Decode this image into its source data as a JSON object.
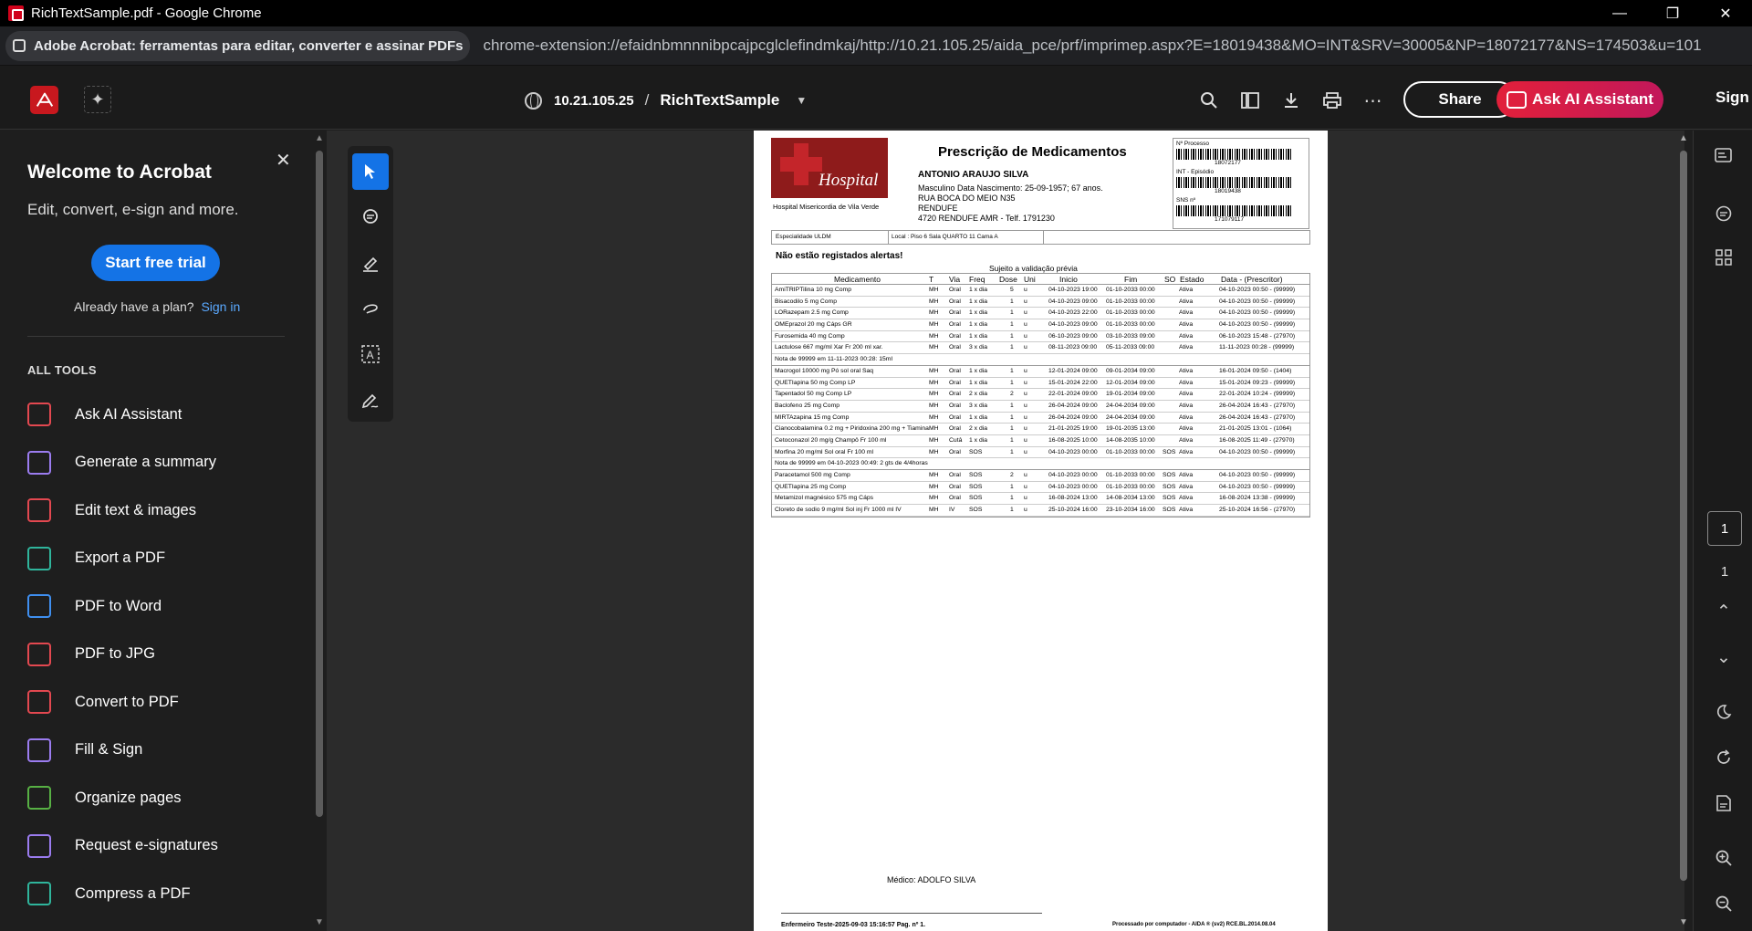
{
  "window": {
    "title": "RichTextSample.pdf - Google Chrome",
    "controls": [
      "—",
      "❐",
      "✕"
    ]
  },
  "addressbar": {
    "extension_label": "Adobe Acrobat: ferramentas para editar, converter e assinar PDFs",
    "url": "chrome-extension://efaidnbmnnnibpcajpcglclefindmkaj/http://10.21.105.25/aida_pce/prf/imprimep.aspx?E=18019438&MO=INT&SRV=30005&NP=18072177&NS=174503&u=101"
  },
  "toolbar": {
    "host": "10.21.105.25",
    "separator": "/",
    "document": "RichTextSample",
    "share_label": "Share",
    "ai_label": "Ask AI Assistant",
    "signin_label": "Sign in",
    "icons": [
      "search-icon",
      "pages-icon",
      "download-icon",
      "print-icon",
      "more-icon"
    ]
  },
  "left_panel": {
    "title": "Welcome to Acrobat",
    "subtitle": "Edit, convert, e-sign and more.",
    "trial_label": "Start free trial",
    "plan_text": "Already have a plan?",
    "plan_link": "Sign in",
    "section": "ALL TOOLS",
    "tools": [
      {
        "label": "Ask AI Assistant",
        "color": "#e34850"
      },
      {
        "label": "Generate a summary",
        "color": "#9b7cf0"
      },
      {
        "label": "Edit text & images",
        "color": "#e34850"
      },
      {
        "label": "Export a PDF",
        "color": "#2fb59c"
      },
      {
        "label": "PDF to Word",
        "color": "#3f8ff0"
      },
      {
        "label": "PDF to JPG",
        "color": "#e34850"
      },
      {
        "label": "Convert to PDF",
        "color": "#e34850"
      },
      {
        "label": "Fill & Sign",
        "color": "#9b7cf0"
      },
      {
        "label": "Organize pages",
        "color": "#57b044"
      },
      {
        "label": "Request e-signatures",
        "color": "#9b7cf0"
      },
      {
        "label": "Compress a PDF",
        "color": "#2fb59c"
      }
    ]
  },
  "document": {
    "hospital_logo_text": "Hospital",
    "hospital_name": "Hospital Misericordia de Vila Verde",
    "title": "Prescrição de Medicamentos",
    "patient_name": "ANTONIO ARAUJO SILVA",
    "patient_lines": [
      "Masculino Data Nascimento: 25-09-1957; 67 anos.",
      "RUA BOCA DO MEIO N35",
      "RENDUFE",
      "4720 RENDUFE AMR - Telf. 1791230"
    ],
    "barcodes": [
      {
        "label": "Nº Processo",
        "number": "18072177"
      },
      {
        "label": "INT - Episódio",
        "number": "18019438"
      },
      {
        "label": "SNS nº",
        "number": "171079117"
      }
    ],
    "especialidade": "Especialidade ULDM",
    "local": "Local : Piso 6 Sala QUARTO 11 Cama A",
    "alerts": "Não estão registados alertas!",
    "sujeito": "Sujeito a validação prévia",
    "columns": [
      "Medicamento",
      "T",
      "Via",
      "Freq",
      "Dose",
      "Uni",
      "Inicio",
      "Fim",
      "SO",
      "Estado",
      "Data - (Prescritor)"
    ],
    "rows": [
      [
        "AmiTRIPTilina 10 mg Comp",
        "MH",
        "Oral",
        "1 x dia",
        "5",
        "u",
        "04-10-2023 19:00",
        "01-10-2033 00:00",
        "",
        "Ativa",
        "04-10-2023 00:50 - (99999)"
      ],
      [
        "Bisacodilo 5 mg Comp",
        "MH",
        "Oral",
        "1 x dia",
        "1",
        "u",
        "04-10-2023 09:00",
        "01-10-2033 00:00",
        "",
        "Ativa",
        "04-10-2023 00:50 - (99999)"
      ],
      [
        "LORazepam 2.5 mg Comp",
        "MH",
        "Oral",
        "1 x dia",
        "1",
        "u",
        "04-10-2023 22:00",
        "01-10-2033 00:00",
        "",
        "Ativa",
        "04-10-2023 00:50 - (99999)"
      ],
      [
        "OMEprazol 20 mg Cáps GR",
        "MH",
        "Oral",
        "1 x dia",
        "1",
        "u",
        "04-10-2023 09:00",
        "01-10-2033 00:00",
        "",
        "Ativa",
        "04-10-2023 00:50 - (99999)"
      ],
      [
        "Furosemida 40 mg Comp",
        "MH",
        "Oral",
        "1 x dia",
        "1",
        "u",
        "06-10-2023 09:00",
        "03-10-2033 09:00",
        "",
        "Ativa",
        "06-10-2023 15:48 - (27970)"
      ],
      [
        "Lactulose 667 mg/ml Xar Fr 200 ml xar.",
        "MH",
        "Oral",
        "3 x dia",
        "1",
        "u",
        "08-11-2023 09:00",
        "05-11-2033 09:00",
        "",
        "Ativa",
        "11-11-2023 00:28 - (99999)"
      ],
      {
        "note": "Nota de 99999 em 11-11-2023 00:28: 15ml"
      },
      [
        "Macrogol 10000 mg Pó sol oral Saq",
        "MH",
        "Oral",
        "1 x dia",
        "1",
        "u",
        "12-01-2024 09:00",
        "09-01-2034 09:00",
        "",
        "Ativa",
        "16-01-2024 09:50 - (1404)"
      ],
      [
        "QUETIapina 50 mg Comp LP",
        "MH",
        "Oral",
        "1 x dia",
        "1",
        "u",
        "15-01-2024 22:00",
        "12-01-2034 09:00",
        "",
        "Ativa",
        "15-01-2024 09:23 - (99999)"
      ],
      [
        "Tapentadol 50 mg Comp LP",
        "MH",
        "Oral",
        "2 x dia",
        "2",
        "u",
        "22-01-2024 09:00",
        "19-01-2034 09:00",
        "",
        "Ativa",
        "22-01-2024 10:24 - (99999)"
      ],
      [
        "Baclofeno 25 mg Comp",
        "MH",
        "Oral",
        "3 x dia",
        "1",
        "u",
        "26-04-2024 09:00",
        "24-04-2034 09:00",
        "",
        "Ativa",
        "26-04-2024 16:43 - (27970)"
      ],
      [
        "MIRTAzapina 15 mg Comp",
        "MH",
        "Oral",
        "1 x dia",
        "1",
        "u",
        "26-04-2024 09:00",
        "24-04-2034 09:00",
        "",
        "Ativa",
        "26-04-2024 16:43 - (27970)"
      ],
      [
        "Cianocobalamina 0.2 mg + Piridoxina 200 mg + Tiamina",
        "MH",
        "Oral",
        "2 x dia",
        "1",
        "u",
        "21-01-2025 19:00",
        "19-01-2035 13:00",
        "",
        "Ativa",
        "21-01-2025 13:01 - (1064)"
      ],
      [
        "Cetoconazol 20 mg/g Champô Fr 100 ml",
        "MH",
        "Cutâ",
        "1 x dia",
        "1",
        "u",
        "16-08-2025 10:00",
        "14-08-2035 10:00",
        "",
        "Ativa",
        "16-08-2025 11:49 - (27970)"
      ],
      [
        "Morfina 20 mg/ml Sol oral Fr 100 ml",
        "MH",
        "Oral",
        "SOS",
        "1",
        "u",
        "04-10-2023 00:00",
        "01-10-2033 00:00",
        "SOS",
        "Ativa",
        "04-10-2023 00:50 - (99999)"
      ],
      {
        "note": "Nota de 99999 em 04-10-2023 00:49: 2 gts de 4/4horas"
      },
      [
        "Paracetamol 500 mg Comp",
        "MH",
        "Oral",
        "SOS",
        "2",
        "u",
        "04-10-2023 00:00",
        "01-10-2033 00:00",
        "SOS",
        "Ativa",
        "04-10-2023 00:50 - (99999)"
      ],
      [
        "QUETIapina 25 mg Comp",
        "MH",
        "Oral",
        "SOS",
        "1",
        "u",
        "04-10-2023 00:00",
        "01-10-2033 00:00",
        "SOS",
        "Ativa",
        "04-10-2023 00:50 - (99999)"
      ],
      [
        "Metamizol magnésico 575 mg Cáps",
        "MH",
        "Oral",
        "SOS",
        "1",
        "u",
        "16-08-2024 13:00",
        "14-08-2034 13:00",
        "SOS",
        "Ativa",
        "16-08-2024 13:38 - (99999)"
      ],
      [
        "Cloreto de sodio 9 mg/ml Sol inj Fr 1000 ml IV",
        "MH",
        "IV",
        "SOS",
        "1",
        "u",
        "25-10-2024 16:00",
        "23-10-2034 16:00",
        "SOS",
        "Ativa",
        "25-10-2024 16:56 - (27970)"
      ]
    ],
    "medico": "Médico: ADOLFO SILVA",
    "footer_left": "Enfermeiro Teste-2025-09-03 15:16:57 Pag. nº 1.",
    "footer_right": "Processado por computador - AIDA ® (sv2) RCE.BL.2014.08.04"
  },
  "pager": {
    "current": "1",
    "total": "1"
  }
}
